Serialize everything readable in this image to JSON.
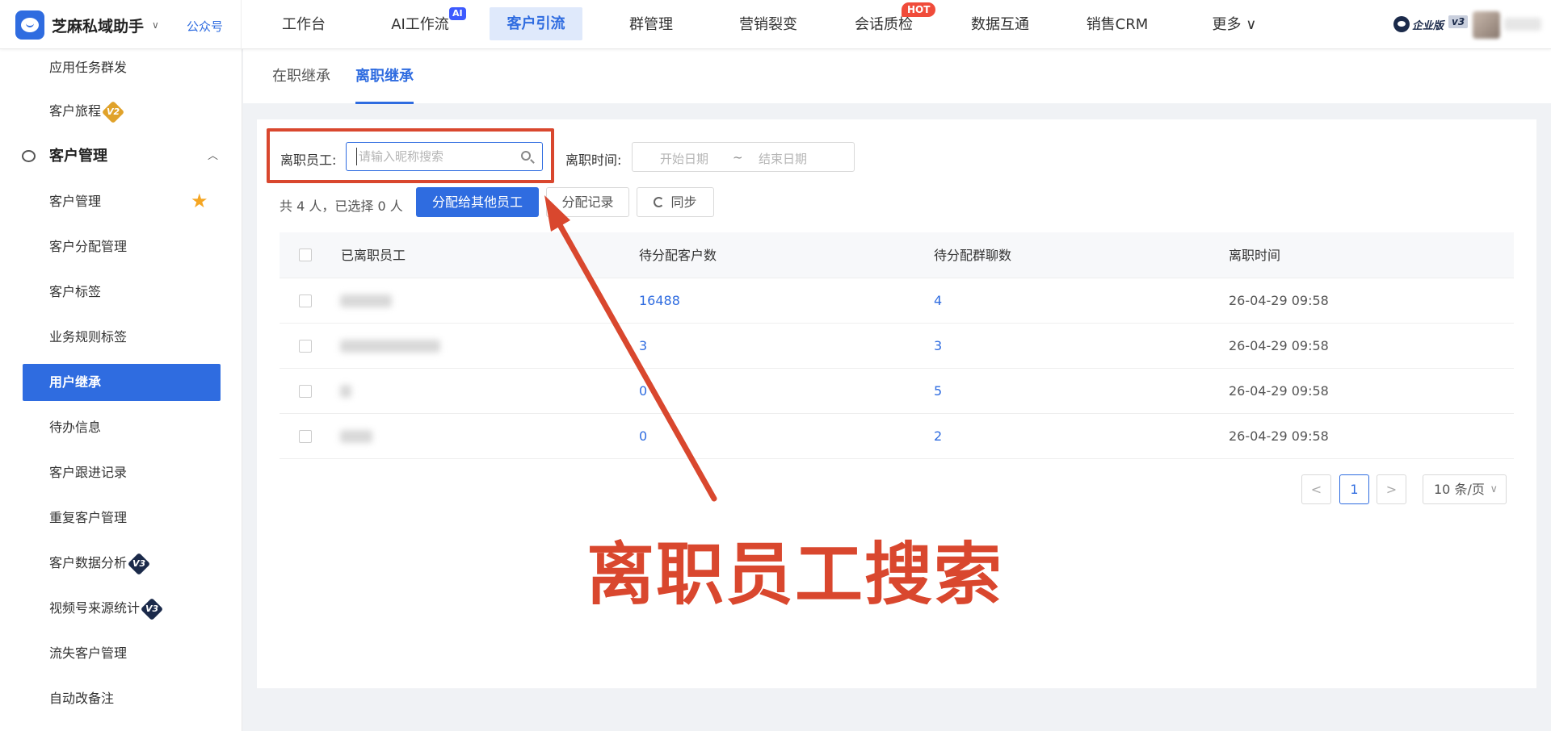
{
  "brand": {
    "name": "芝麻私域助手",
    "caret": "∨",
    "gzh": "公众号"
  },
  "nav": [
    {
      "label": "工作台"
    },
    {
      "label": "AI工作流",
      "badge": "AI"
    },
    {
      "label": "客户引流",
      "active": true
    },
    {
      "label": "群管理"
    },
    {
      "label": "营销裂变"
    },
    {
      "label": "会话质检",
      "badge": "HOT"
    },
    {
      "label": "数据互通"
    },
    {
      "label": "销售CRM"
    },
    {
      "label": "更多 ∨"
    }
  ],
  "account": {
    "edition": "企业版",
    "version": "v3"
  },
  "sidebar": {
    "items": [
      {
        "label": "应用任务群发"
      },
      {
        "label": "客户旅程",
        "badge": "V2"
      },
      {
        "label": "客户管理",
        "group": true,
        "caret": "︿"
      },
      {
        "label": "客户管理",
        "starred": true
      },
      {
        "label": "客户分配管理"
      },
      {
        "label": "客户标签"
      },
      {
        "label": "业务规则标签"
      },
      {
        "label": "用户继承",
        "active": true
      },
      {
        "label": "待办信息"
      },
      {
        "label": "客户跟进记录"
      },
      {
        "label": "重复客户管理"
      },
      {
        "label": "客户数据分析",
        "badge": "V3"
      },
      {
        "label": "视频号来源统计",
        "badge": "V3"
      },
      {
        "label": "流失客户管理"
      },
      {
        "label": "自动改备注"
      }
    ]
  },
  "tabs": [
    {
      "label": "在职继承"
    },
    {
      "label": "离职继承",
      "active": true
    }
  ],
  "filters": {
    "employee_label": "离职员工:",
    "employee_placeholder": "请输入昵称搜索",
    "time_label": "离职时间:",
    "start_placeholder": "开始日期",
    "range_sep": "~",
    "end_placeholder": "结束日期"
  },
  "toolbar": {
    "summary": "共 4 人，已选择 0 人",
    "assign_button": "分配给其他员工",
    "records_button": "分配记录",
    "sync_button": "同步"
  },
  "table": {
    "columns": [
      "已离职员工",
      "待分配客户数",
      "待分配群聊数",
      "离职时间"
    ],
    "rows": [
      {
        "customers": "16488",
        "groups": "4",
        "time": "26-04-29 09:58"
      },
      {
        "customers": "3",
        "groups": "3",
        "time": "26-04-29 09:58"
      },
      {
        "customers": "0",
        "groups": "5",
        "time": "26-04-29 09:58"
      },
      {
        "customers": "0",
        "groups": "2",
        "time": "26-04-29 09:58"
      }
    ]
  },
  "pagination": {
    "prev": "<",
    "page": "1",
    "next": ">",
    "size": "10 条/页"
  },
  "annotation": {
    "text": "离职员工搜索",
    "color": "#d9472e"
  },
  "colors": {
    "primary": "#2f6ce0",
    "annotation": "#d9472e",
    "hot": "#f04b3a",
    "badge_v2": "#e0a22a",
    "badge_v3": "#1b2a4a"
  }
}
